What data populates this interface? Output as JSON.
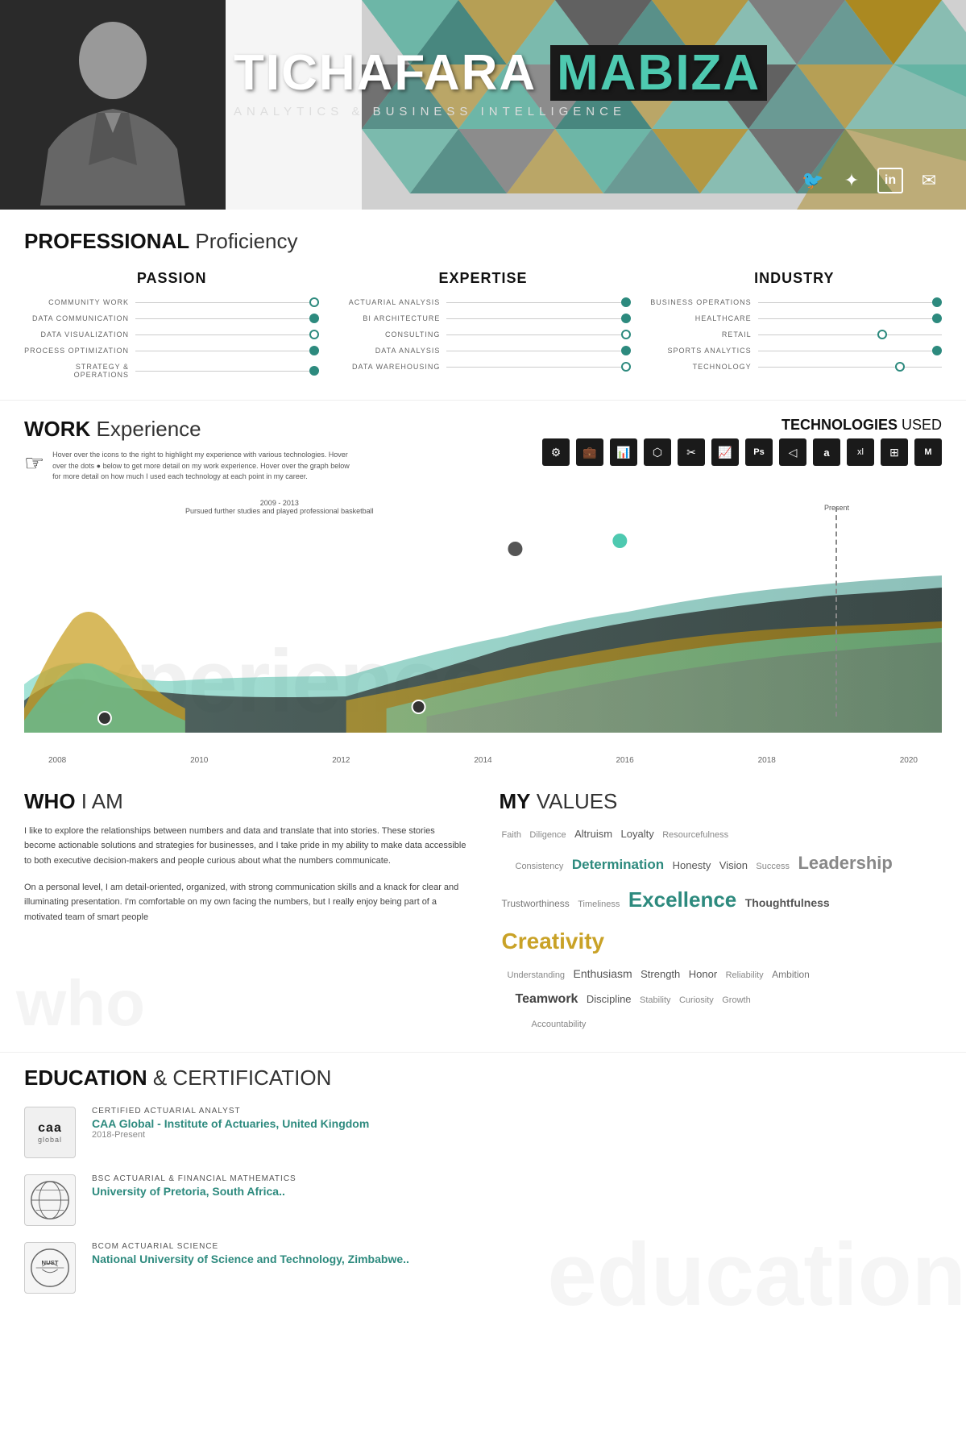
{
  "header": {
    "first_name": "TICHAFARA",
    "last_name": "MABIZA",
    "subtitle": "ANALYTICS  &  BUSINESS  INTELLIGENCE",
    "social_icons": [
      "🐦",
      "✦",
      "in",
      "✉"
    ]
  },
  "proficiency": {
    "section_title_bold": "PROFESSIONAL",
    "section_title_light": " Proficiency",
    "passion": {
      "title": "PASSION",
      "skills": [
        {
          "label": "COMMUNITY WORK",
          "level": 3
        },
        {
          "label": "DATA COMMUNICATION",
          "level": 4
        },
        {
          "label": "DATA VISUALIZATION",
          "level": 3
        },
        {
          "label": "PROCESS OPTIMIZATION",
          "level": 3
        },
        {
          "label": "STRATEGY & OPERATIONS",
          "level": 3
        }
      ]
    },
    "expertise": {
      "title": "EXPERTISE",
      "skills": [
        {
          "label": "ACTUARIAL ANALYSIS",
          "level": 4
        },
        {
          "label": "BI ARCHITECTURE",
          "level": 4
        },
        {
          "label": "CONSULTING",
          "level": 3
        },
        {
          "label": "DATA ANALYSIS",
          "level": 4
        },
        {
          "label": "DATA WAREHOUSING",
          "level": 3
        }
      ]
    },
    "industry": {
      "title": "INDUSTRY",
      "skills": [
        {
          "label": "BUSINESS OPERATIONS",
          "level": 5
        },
        {
          "label": "HEALTHCARE",
          "level": 5
        },
        {
          "label": "RETAIL",
          "level": 3
        },
        {
          "label": "SPORTS ANALYTICS",
          "level": 4
        },
        {
          "label": "TECHNOLOGY",
          "level": 3
        }
      ]
    }
  },
  "work": {
    "section_title_bold": "WORK",
    "section_title_light": " Experience",
    "tech_title_bold": "TECHNOLOGIES",
    "tech_title_light": " USED",
    "description_line1": "Hover over the icons to the right to highlight my experience with various technologies. Hover",
    "description_line2": "over the dots ● below to get more detail on my work experience. Hover over the graph below",
    "description_line3": "for more detail on how much I used each technology at each point in my career.",
    "annotation": "2009 - 2013\nPursued further studies and played professional basketball",
    "present_label": "Present",
    "x_labels": [
      "2008",
      "2010",
      "2012",
      "2014",
      "2016",
      "2018",
      "2020"
    ],
    "tech_icons": [
      "⚙",
      "💼",
      "📊",
      "⬡",
      "✂",
      "📈",
      "Ps",
      "◁",
      "🅐",
      "📋",
      "⊞",
      "⊳"
    ]
  },
  "who": {
    "section_title_bold": "WHO",
    "section_title_light": " I AM",
    "para1": "I like to explore the relationships between numbers and data and translate that into stories. These stories become actionable solutions and strategies for businesses, and I take pride in my ability to make data accessible to both executive decision-makers and people curious about what the numbers communicate.",
    "para2": "On a personal level, I am detail-oriented, organized, with strong communication skills and a knack for clear and illuminating presentation. I'm comfortable on my own facing the numbers, but I really enjoy being part of a motivated team of smart people"
  },
  "values": {
    "section_title_bold": "MY",
    "section_title_light": " VALUES",
    "words": [
      {
        "text": "Faith",
        "size": "sm"
      },
      {
        "text": "Diligence",
        "size": "sm"
      },
      {
        "text": "Altruism",
        "size": "md"
      },
      {
        "text": "Loyalty",
        "size": "md"
      },
      {
        "text": "Resourcefulness",
        "size": "sm"
      },
      {
        "text": "Consistency",
        "size": "sm"
      },
      {
        "text": "Determination",
        "size": "lg"
      },
      {
        "text": "Honesty",
        "size": "md"
      },
      {
        "text": "Vision",
        "size": "md"
      },
      {
        "text": "Success",
        "size": "sm"
      },
      {
        "text": "Leadership",
        "size": "lead"
      },
      {
        "text": "Trustworthiness",
        "size": "md"
      },
      {
        "text": "Timeliness",
        "size": "sm"
      },
      {
        "text": "Excellence",
        "size": "xl"
      },
      {
        "text": "Thoughtfulness",
        "size": "lg"
      },
      {
        "text": "Creativity",
        "size": "xxl"
      },
      {
        "text": "Understanding",
        "size": "sm"
      },
      {
        "text": "Enthusiasm",
        "size": "md"
      },
      {
        "text": "Strength",
        "size": "md"
      },
      {
        "text": "Honor",
        "size": "md"
      },
      {
        "text": "Reliability",
        "size": "sm"
      },
      {
        "text": "Teamwork",
        "size": "lg"
      },
      {
        "text": "Discipline",
        "size": "md"
      },
      {
        "text": "Stability",
        "size": "sm"
      },
      {
        "text": "Curiosity",
        "size": "sm"
      },
      {
        "text": "Ambition",
        "size": "sm"
      },
      {
        "text": "Growth",
        "size": "sm"
      },
      {
        "text": "Accountability",
        "size": "sm"
      }
    ]
  },
  "education": {
    "section_title_bold": "EDUCATION",
    "section_title_light": " & CERTIFICATION",
    "items": [
      {
        "logo": "caa\nglobal",
        "cert_bold": "CERTIFIED ACTUARIAL",
        "cert_light": " ANALYST",
        "institution": "CAA Global - Institute of Actuaries, United Kingdom",
        "year": "2018-Present"
      },
      {
        "logo": "U\nPret",
        "cert_bold": "BSC ACTUARIAL",
        "cert_light": " & FINANCIAL MATHEMATICS",
        "institution": "University of Pretoria, South Africa..",
        "year": ""
      },
      {
        "logo": "NUST\nZim",
        "cert_bold": "BCOM ACTUARIAL",
        "cert_light": " SCIENCE",
        "institution": "National University of Science and Technology, Zimbabwe..",
        "year": ""
      }
    ]
  }
}
